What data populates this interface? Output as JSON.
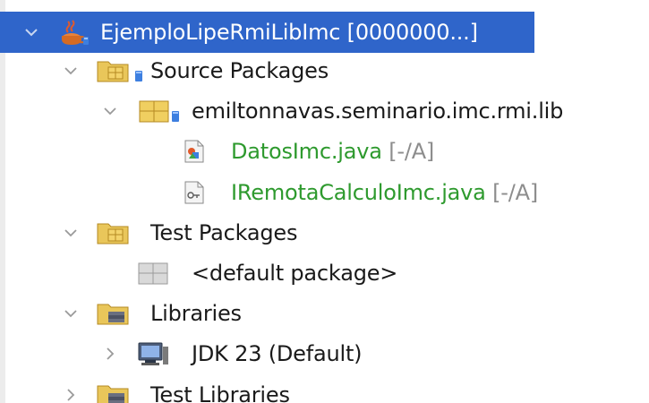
{
  "tree": {
    "project": {
      "label": "EjemploLipeRmiLibImc [0000000...]",
      "expanded": true,
      "selected": true
    },
    "source_packages": {
      "label": "Source Packages",
      "expanded": true
    },
    "package": {
      "label": "emiltonnavas.seminario.imc.rmi.lib",
      "expanded": true
    },
    "files": [
      {
        "name": "DatosImc.java",
        "status": "[-/A]"
      },
      {
        "name": "IRemotaCalculoImc.java",
        "status": "[-/A]"
      }
    ],
    "test_packages": {
      "label": "Test Packages",
      "expanded": true
    },
    "default_package": {
      "label": "<default package>"
    },
    "libraries": {
      "label": "Libraries",
      "expanded": true
    },
    "jdk": {
      "label": "JDK 23 (Default)",
      "expanded": false
    },
    "test_libraries": {
      "label": "Test Libraries",
      "expanded": false
    }
  },
  "colors": {
    "selection": "#2f65ca",
    "versioned_file": "#2e9a2e",
    "status_text": "#8d8d8d",
    "folder": "#e5b84a"
  }
}
